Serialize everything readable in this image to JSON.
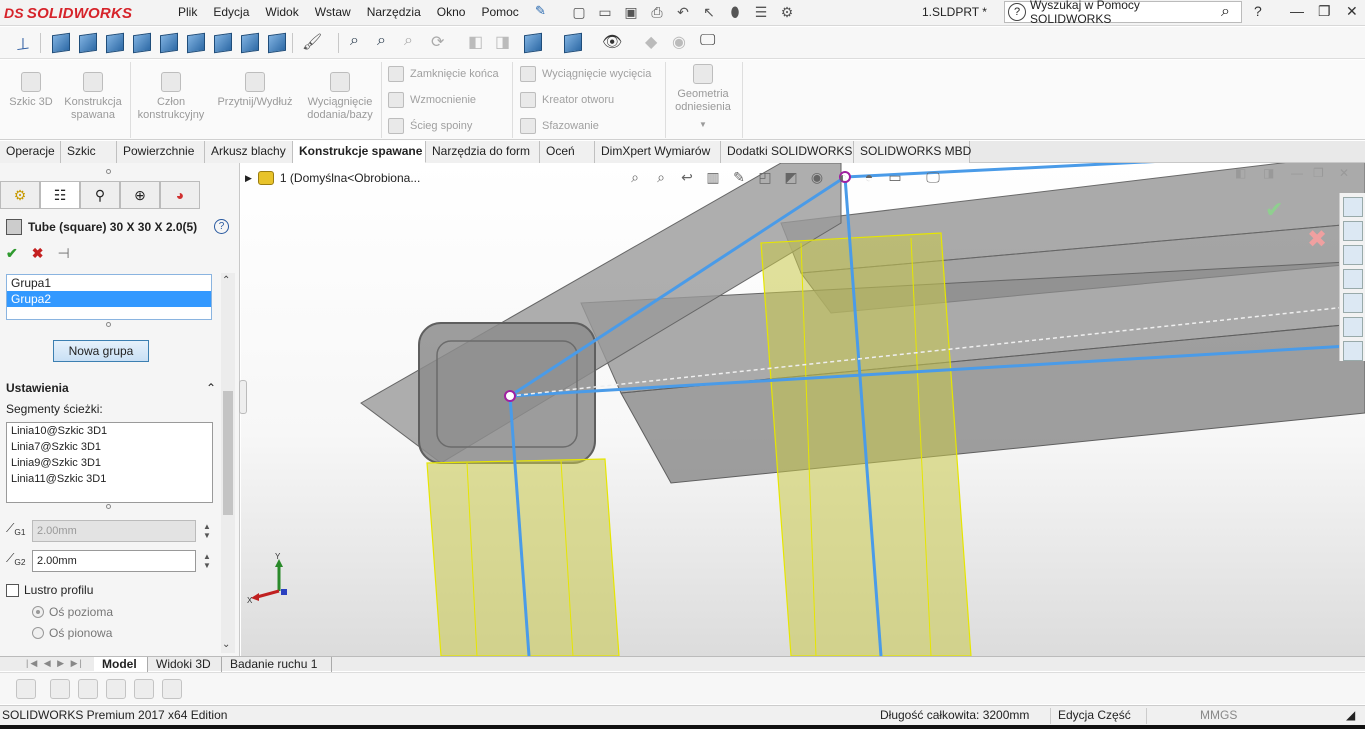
{
  "app": {
    "brand": "SOLIDWORKS",
    "brand_prefix": "DS",
    "document_title": "1.SLDPRT *",
    "accent_color": "#d6232a"
  },
  "menu": [
    "Plik",
    "Edycja",
    "Widok",
    "Wstaw",
    "Narzędzia",
    "Okno",
    "Pomoc"
  ],
  "help_search": {
    "placeholder": "Wyszukaj w Pomocy SOLIDWORKS",
    "help": "?"
  },
  "ribbon": {
    "big_buttons": [
      {
        "label": "Szkic 3D"
      },
      {
        "label": "Konstrukcja spawana"
      },
      {
        "label": "Człon konstrukcyjny"
      },
      {
        "label": "Przytnij/Wydłuż"
      },
      {
        "label": "Wyciągnięcie dodania/bazy"
      },
      {
        "label": "Geometria odniesienia"
      }
    ],
    "small_buttons_col1": [
      "Zamknięcie końca",
      "Wzmocnienie",
      "Ścieg spoiny"
    ],
    "small_buttons_col2": [
      "Wyciągnięcie wycięcia",
      "Kreator otworu",
      "Sfazowanie"
    ]
  },
  "command_tabs": [
    {
      "label": "Operacje"
    },
    {
      "label": "Szkic"
    },
    {
      "label": "Powierzchnie"
    },
    {
      "label": "Arkusz blachy"
    },
    {
      "label": "Konstrukcje spawane",
      "active": true
    },
    {
      "label": "Narzędzia do form"
    },
    {
      "label": "Oceń"
    },
    {
      "label": "DimXpert Wymiarów"
    },
    {
      "label": "Dodatki SOLIDWORKS"
    },
    {
      "label": "SOLIDWORKS MBD"
    }
  ],
  "property_manager": {
    "title": "Tube (square) 30 X 30 X 2.0(5)",
    "groups": [
      {
        "label": "Grupa1",
        "selected": false
      },
      {
        "label": "Grupa2",
        "selected": true
      }
    ],
    "new_group_button": "Nowa grupa",
    "settings_header": "Ustawienia",
    "segments_label": "Segmenty ścieżki:",
    "segments": [
      "Linia10@Szkic 3D1",
      "Linia7@Szkic 3D1",
      "Linia9@Szkic 3D1",
      "Linia11@Szkic 3D1"
    ],
    "gap1_label": "G1",
    "gap1_value": "2.00mm",
    "gap2_label": "G2",
    "gap2_value": "2.00mm",
    "mirror_profile_label": "Lustro profilu",
    "mirror_profile_checked": false,
    "axis_horizontal_label": "Oś pozioma",
    "axis_vertical_label": "Oś pionowa"
  },
  "graphics": {
    "tree_item": "1  (Domyślna<Obrobiona...",
    "triad_x": "X",
    "triad_y": "Y"
  },
  "bottom_tabs": [
    {
      "label": "Model",
      "active": true
    },
    {
      "label": "Widoki 3D"
    },
    {
      "label": "Badanie ruchu 1"
    }
  ],
  "status": {
    "edition": "SOLIDWORKS Premium 2017 x64 Edition",
    "total_length": "Długość całkowita: 3200mm",
    "edit_mode": "Edycja Część",
    "units": "MMGS"
  }
}
